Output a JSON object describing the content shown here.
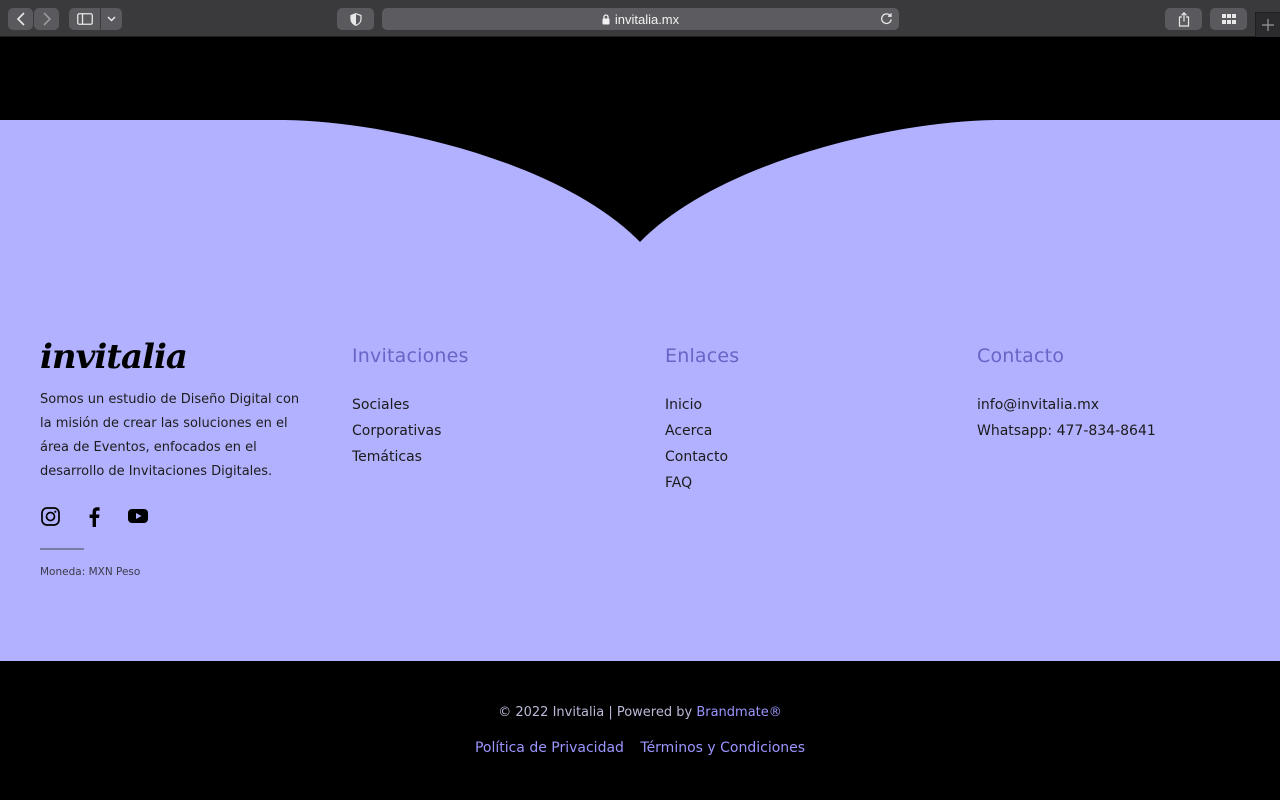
{
  "browser": {
    "url": "invitalia.mx",
    "icons": [
      "back-icon",
      "forward-icon",
      "sidebar-icon",
      "chevron-down-icon",
      "shield-icon",
      "lock-icon",
      "reload-icon",
      "share-icon",
      "tab-overview-icon",
      "plus-icon"
    ]
  },
  "colors": {
    "lavender": "#b1b1ff",
    "heading": "#6b63c6",
    "link": "#9b95ff",
    "black": "#000000"
  },
  "brand": {
    "logo": "invitalia",
    "description": "Somos un estudio de Diseño Digital con la misión de crear las soluciones en el área de Eventos, enfocados en el desarrollo de Invitaciones Digitales.",
    "social": [
      "instagram-icon",
      "facebook-icon",
      "youtube-icon"
    ],
    "currency": "Moneda: MXN Peso"
  },
  "invitaciones": {
    "title": "Invitaciones",
    "items": [
      "Sociales",
      "Corporativas",
      "Temáticas"
    ]
  },
  "enlaces": {
    "title": "Enlaces",
    "items": [
      "Inicio",
      "Acerca",
      "Contacto",
      "FAQ"
    ]
  },
  "contacto": {
    "title": "Contacto",
    "items": [
      "info@invitalia.mx",
      "Whatsapp: 477-834-8641"
    ]
  },
  "footer": {
    "copyright": "© 2022 Invitalia | Powered by ",
    "powered_by": "Brandmate®",
    "links": [
      "Política de Privacidad",
      "Términos y Condiciones"
    ]
  }
}
